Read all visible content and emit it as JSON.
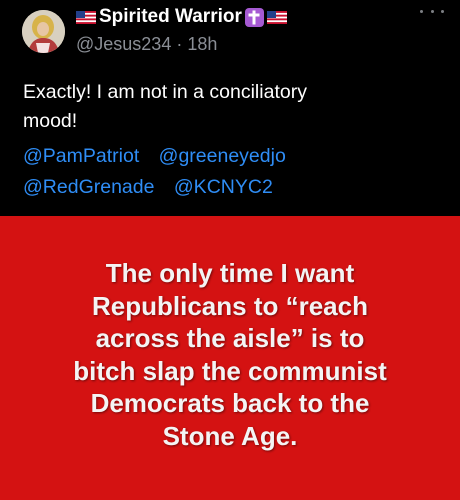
{
  "post": {
    "author": {
      "display_name": "Spirited Warrior",
      "name_emojis": [
        "us-flag",
        "latin-cross",
        "us-flag"
      ],
      "handle": "@Jesus234",
      "separator": "·",
      "time_ago": "18h"
    },
    "text_lines": [
      "Exactly! I am not in a conciliatory",
      "mood!"
    ],
    "mentions": {
      "line1": [
        "@PamPatriot",
        "@greeneyedjo"
      ],
      "line2": [
        "@RedGrenade",
        "@KCNYC2"
      ]
    },
    "image": {
      "background_color": "#d41212",
      "text_lines": [
        "The only time I want",
        "Republicans to “reach",
        "across the aisle” is to",
        "bitch slap the communist",
        "Democrats back to the",
        "Stone Age."
      ]
    }
  },
  "colors": {
    "background": "#000000",
    "mention_link": "#2f8df5",
    "handle_gray": "#8b8f96",
    "cross_badge": "#a65ad3"
  }
}
